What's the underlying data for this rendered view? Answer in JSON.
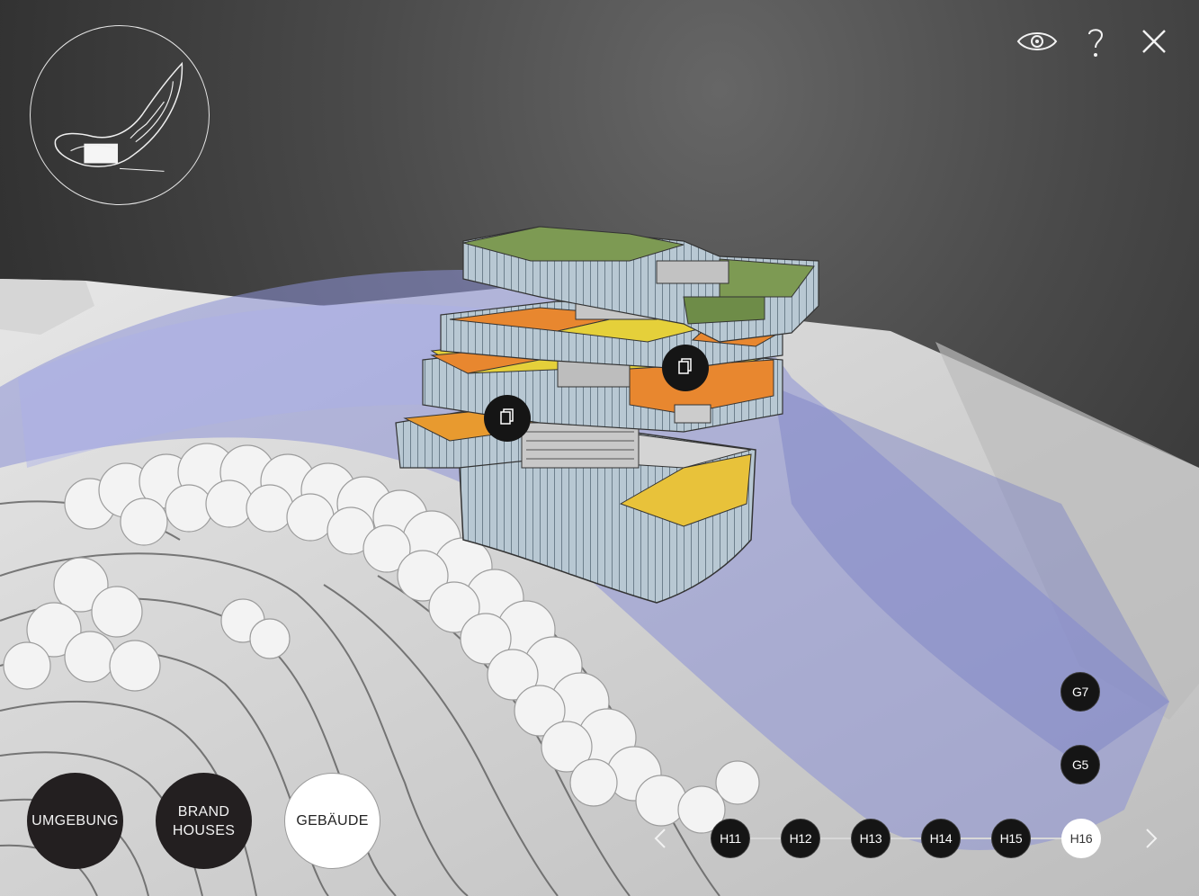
{
  "toolbar": {
    "visibility_icon": "eye-icon",
    "help_icon": "question-icon",
    "close_icon": "close-icon"
  },
  "minimap": {
    "icon": "site-map-icon"
  },
  "modes": [
    {
      "label": "UMGEBUNG",
      "state": "inactive"
    },
    {
      "label": "BRAND\nHOUSES",
      "state": "inactive"
    },
    {
      "label": "GEBÄUDE",
      "state": "active"
    }
  ],
  "floors": {
    "vertical": [
      "G7",
      "G5"
    ],
    "horizontal": [
      "H11",
      "H12",
      "H13",
      "H14",
      "H15",
      "H16"
    ],
    "selected": "H16",
    "prev_icon": "chevron-left-icon",
    "next_icon": "chevron-right-icon"
  },
  "markers": [
    {
      "icon": "document-icon"
    },
    {
      "icon": "document-icon"
    }
  ],
  "colors": {
    "background": "#3a3a3a",
    "accent_orange": "#e8872f",
    "accent_yellow": "#e5cf3a",
    "water_blue": "#8c91d6",
    "roof_green": "#7d9a53",
    "button_dark": "#231f20"
  }
}
